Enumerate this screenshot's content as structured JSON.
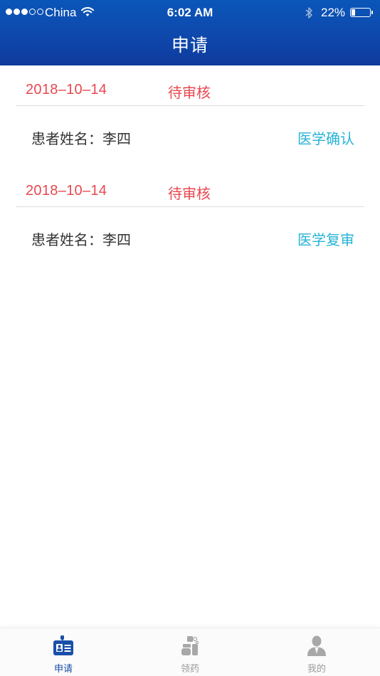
{
  "status_bar": {
    "carrier": "China",
    "time": "6:02 AM",
    "battery_percent": "22%",
    "battery_level": 0.22,
    "signal_bars_filled": 3,
    "signal_bars_total": 5
  },
  "nav": {
    "title": "申请"
  },
  "applications": [
    {
      "date": "2018–10–14",
      "status": "待审核",
      "patient_label": "患者姓名：李四",
      "action": "医学确认"
    },
    {
      "date": "2018–10–14",
      "status": "待审核",
      "patient_label": "患者姓名：李四",
      "action": "医学复审"
    }
  ],
  "tabbar": {
    "items": [
      {
        "label": "申请",
        "icon": "id-card-icon",
        "active": true
      },
      {
        "label": "领药",
        "icon": "medicine-icon",
        "active": false
      },
      {
        "label": "我的",
        "icon": "person-icon",
        "active": false
      }
    ]
  },
  "colors": {
    "nav_blue": "#0f48ad",
    "status_red": "#e8474f",
    "action_cyan": "#27b3d6",
    "tab_active": "#1a4fa8",
    "tab_inactive": "#9a9a9a"
  }
}
